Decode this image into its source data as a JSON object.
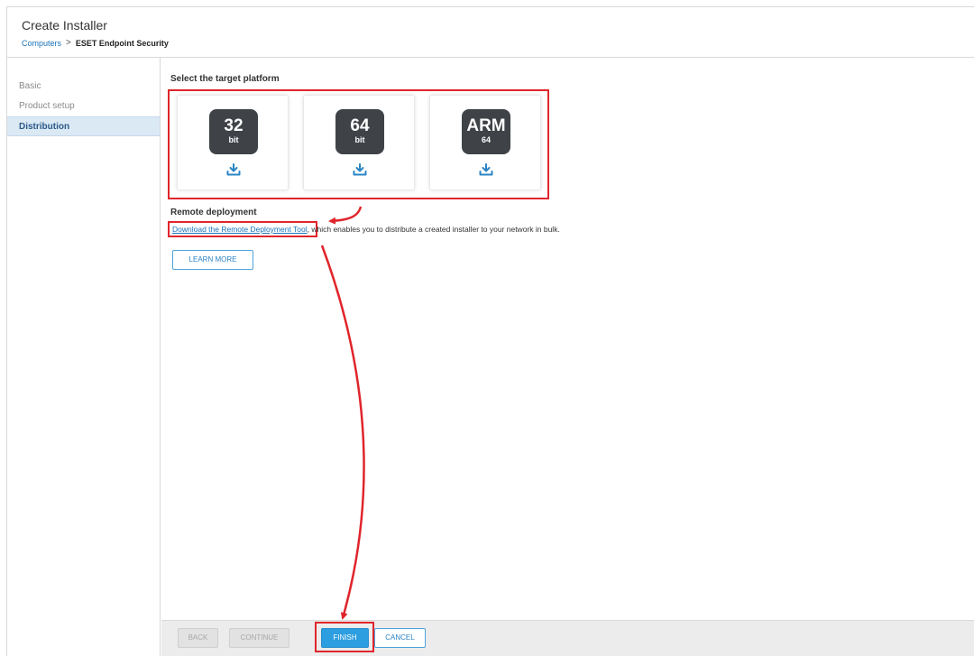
{
  "header": {
    "title": "Create Installer",
    "breadcrumb": {
      "parent": "Computers",
      "separator": ">",
      "current": "ESET Endpoint Security"
    }
  },
  "sidebar": {
    "items": [
      {
        "label": "Basic",
        "active": false
      },
      {
        "label": "Product setup",
        "active": false
      },
      {
        "label": "Distribution",
        "active": true
      }
    ]
  },
  "main": {
    "platform_title": "Select the target platform",
    "platforms": [
      {
        "big": "32",
        "small": "bit",
        "icon": "download-icon"
      },
      {
        "big": "64",
        "small": "bit",
        "icon": "download-icon"
      },
      {
        "big": "ARM",
        "small": "64",
        "icon": "download-icon"
      }
    ],
    "remote_title": "Remote deployment",
    "remote_link": "Download the Remote Deployment Tool",
    "remote_desc": ", which enables you to distribute a created installer to your network in bulk.",
    "learn_more": "LEARN MORE"
  },
  "footer": {
    "back": "BACK",
    "continue": "CONTINUE",
    "finish": "FINISH",
    "cancel": "CANCEL"
  },
  "colors": {
    "accent": "#2d9ee0",
    "link": "#1a73b8",
    "annotation": "#e0252b",
    "chip": "#3f4348",
    "sidebar_active": "#dbe9f5"
  }
}
